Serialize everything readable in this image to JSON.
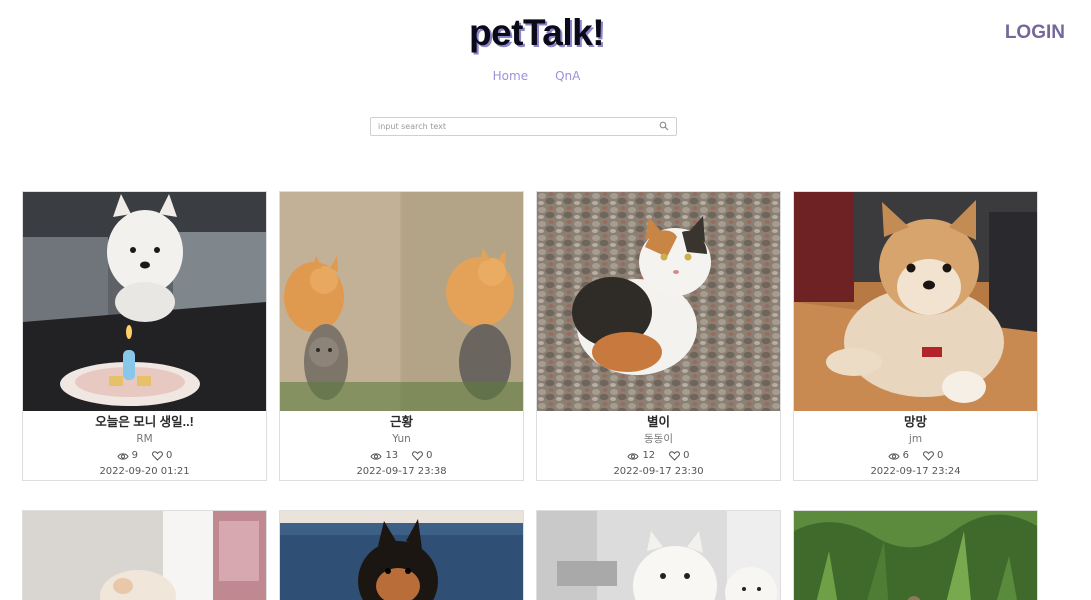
{
  "app": {
    "title": "petTalk!",
    "login_label": "LOGIN"
  },
  "nav": [
    {
      "label": "Home"
    },
    {
      "label": "QnA"
    }
  ],
  "search": {
    "placeholder": "input search text",
    "value": ""
  },
  "icons": {
    "search": "search-icon",
    "views": "eye-icon",
    "likes": "heart-icon"
  },
  "colors": {
    "brand_text": "#0b0a18",
    "brand_shadow": "#8a86c8",
    "nav_link": "#9b93d8",
    "login": "#75679a"
  },
  "posts": [
    {
      "title": "오늘은 모니 생일..!",
      "author": "RM",
      "views": "9",
      "likes": "0",
      "date": "2022-09-20 01:21",
      "photo": "white dog with birthday candle"
    },
    {
      "title": "근황",
      "author": "Yun",
      "views": "13",
      "likes": "0",
      "date": "2022-09-17 23:38",
      "photo": "orange and tabby cats"
    },
    {
      "title": "별이",
      "author": "동동이",
      "views": "12",
      "likes": "0",
      "date": "2022-09-17 23:30",
      "photo": "calico cat on gravel"
    },
    {
      "title": "망망",
      "author": "jm",
      "views": "6",
      "likes": "0",
      "date": "2022-09-17 23:24",
      "photo": "pomeranian on wooden floor"
    }
  ],
  "posts_row2": [
    {
      "photo": "fluffy dog by window"
    },
    {
      "photo": "black and tan pomeranian on couch"
    },
    {
      "photo": "two white pomeranians"
    },
    {
      "photo": "grass and plants"
    }
  ]
}
